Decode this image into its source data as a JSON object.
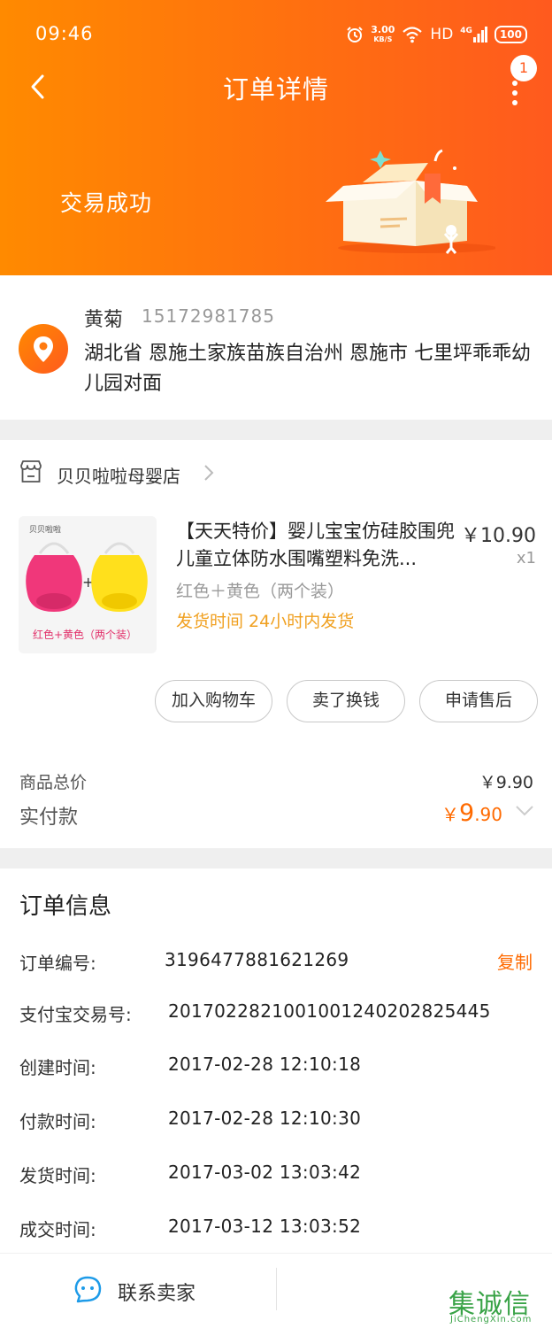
{
  "status_bar": {
    "time": "09:46",
    "net_speed": "3.00",
    "net_unit": "KB/S",
    "hd": "HD",
    "network": "4G",
    "battery": "100"
  },
  "nav": {
    "title": "订单详情",
    "more_badge": "1"
  },
  "header": {
    "trade_status": "交易成功"
  },
  "address": {
    "name": "黄菊",
    "phone": "15172981785",
    "detail": "湖北省 恩施土家族苗族自治州 恩施市 七里坪乖乖幼儿园对面"
  },
  "shop": {
    "name": "贝贝啦啦母婴店"
  },
  "product": {
    "title": "【天天特价】婴儿宝宝仿硅胶围兜儿童立体防水围嘴塑料免洗...",
    "price": "￥10.90",
    "qty": "x1",
    "spec": "红色＋黄色（两个装）",
    "ship_note": "发货时间 24小时内发货",
    "thumb_brand": "贝贝啦啦",
    "thumb_caption": "红色+黄色（两个装）"
  },
  "actions": {
    "add_cart": "加入购物车",
    "sell": "卖了换钱",
    "after_sale": "申请售后"
  },
  "totals": {
    "goods_total_label": "商品总价",
    "goods_total_value": "￥9.90",
    "paid_label": "实付款",
    "paid_yen": "￥",
    "paid_int": "9",
    "paid_dec": ".90"
  },
  "order_info": {
    "title": "订单信息",
    "copy_label": "复制",
    "rows": [
      {
        "label": "订单编号:",
        "value": "3196477881621269"
      },
      {
        "label": "支付宝交易号:",
        "value": "2017022821001001240202825445"
      },
      {
        "label": "创建时间:",
        "value": "2017-02-28 12:10:18"
      },
      {
        "label": "付款时间:",
        "value": "2017-02-28 12:10:30"
      },
      {
        "label": "发货时间:",
        "value": "2017-03-02 13:03:42"
      },
      {
        "label": "成交时间:",
        "value": "2017-03-12 13:03:52"
      }
    ]
  },
  "bottom_bar": {
    "contact_label": "联系卖家"
  },
  "watermark": {
    "chars": "集诚信",
    "url": "JiChengXin.com"
  },
  "colors": {
    "accent": "#ff6a00",
    "header_start": "#ff8a00",
    "header_end": "#ff5a1e",
    "ship_note": "#f0a020"
  }
}
